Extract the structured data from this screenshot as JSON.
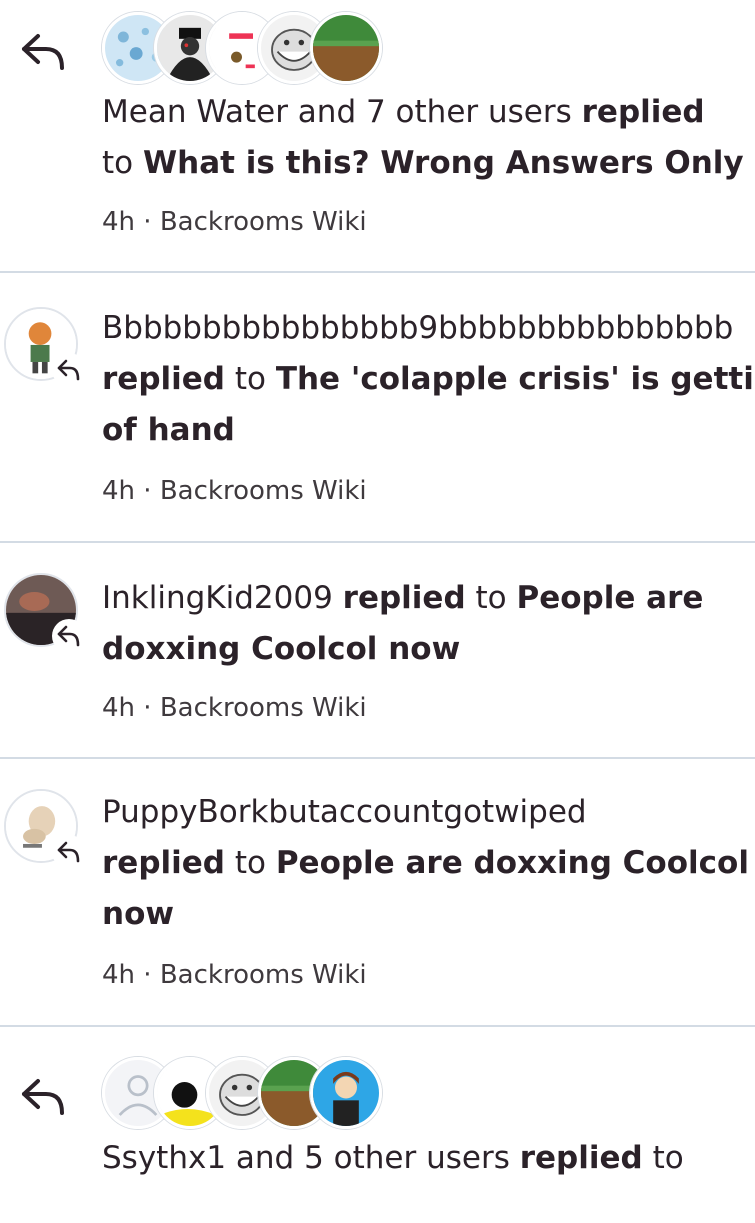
{
  "notifications": [
    {
      "actor": "Mean Water and 7 other users",
      "verb": "replied",
      "connector": "to",
      "target_lines": [
        "What is this? Wrong Answers Only"
      ],
      "time": "4h",
      "separator": "·",
      "wiki": "Backrooms Wiki",
      "icon": "reply-arrow-icon"
    },
    {
      "actor": "Bbbbbbbbbbbbbbbb9bbbbbbbbbbbbbbb",
      "verb": "replied",
      "connector": "to",
      "target_line1": "The 'colapple crisis' is getting out",
      "target_line2": "of hand",
      "time": "4h",
      "separator": "·",
      "wiki": "Backrooms Wiki"
    },
    {
      "actor": "InklingKid2009",
      "verb": "replied",
      "connector": "to",
      "target_line1": "People are",
      "target_line2": "doxxing Coolcol now",
      "time": "4h",
      "separator": "·",
      "wiki": "Backrooms Wiki"
    },
    {
      "actor": "PuppyBorkbutaccountgotwiped",
      "verb": "replied",
      "connector": "to",
      "target_line1": "People are doxxing Coolcol",
      "target_line2": "now",
      "time": "4h",
      "separator": "·",
      "wiki": "Backrooms Wiki"
    },
    {
      "actor": "Ssythx1 and 5 other users",
      "verb": "replied",
      "connector": "to"
    }
  ]
}
